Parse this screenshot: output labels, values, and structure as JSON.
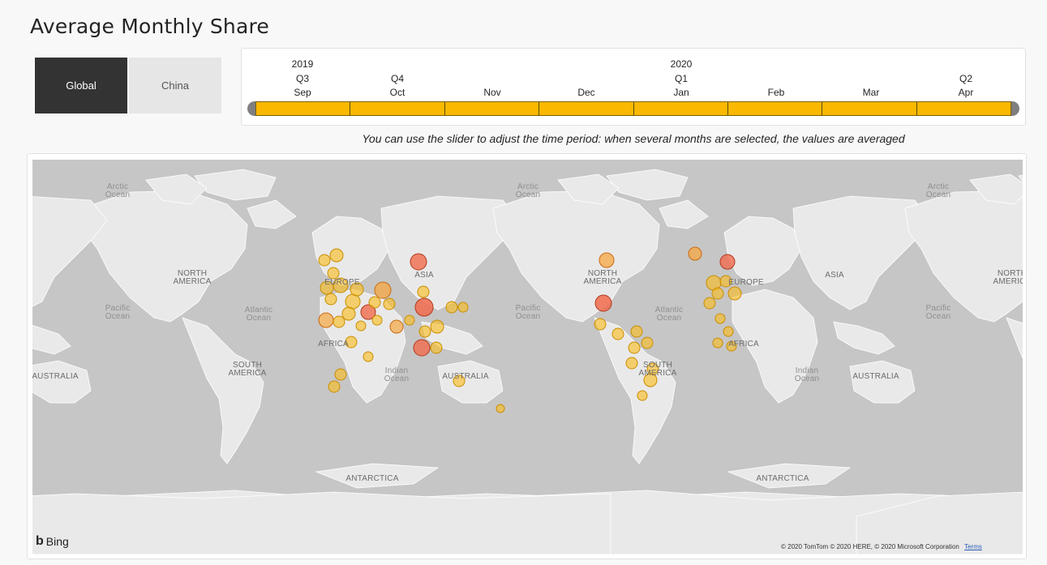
{
  "title": "Average Monthly Share",
  "toggle": {
    "global_label": "Global",
    "china_label": "China"
  },
  "timeline": {
    "years": [
      "2019",
      "2020"
    ],
    "quarters": [
      "Q3",
      "Q4",
      "Q1",
      "Q2"
    ],
    "months": [
      "Sep",
      "Oct",
      "Nov",
      "Dec",
      "Jan",
      "Feb",
      "Mar",
      "Apr"
    ],
    "selected_range": [
      "Sep",
      "Apr"
    ]
  },
  "hint": "You can use the slider to adjust the time period: when several months are selected, the values are averaged",
  "map": {
    "labels": {
      "arctic": "Arctic\nOcean",
      "north_america": "NORTH\nAMERICA",
      "pacific": "Pacific\nOcean",
      "atlantic": "Atlantic\nOcean",
      "south_america": "SOUTH\nAMERICA",
      "europe": "EUROPE",
      "asia": "ASIA",
      "africa": "AFRICA",
      "indian": "Indian\nOcean",
      "australia": "AUSTRALIA",
      "antarctica": "ANTARCTICA"
    },
    "bing_text": "Bing",
    "copyright": "© 2020 TomTom © 2020 HERE, © 2020 Microsoft Corporation",
    "terms": "Terms",
    "bubble_colors": {
      "low": "#fbbd19",
      "mid": "#f5a742",
      "high": "#f06b4c"
    }
  }
}
